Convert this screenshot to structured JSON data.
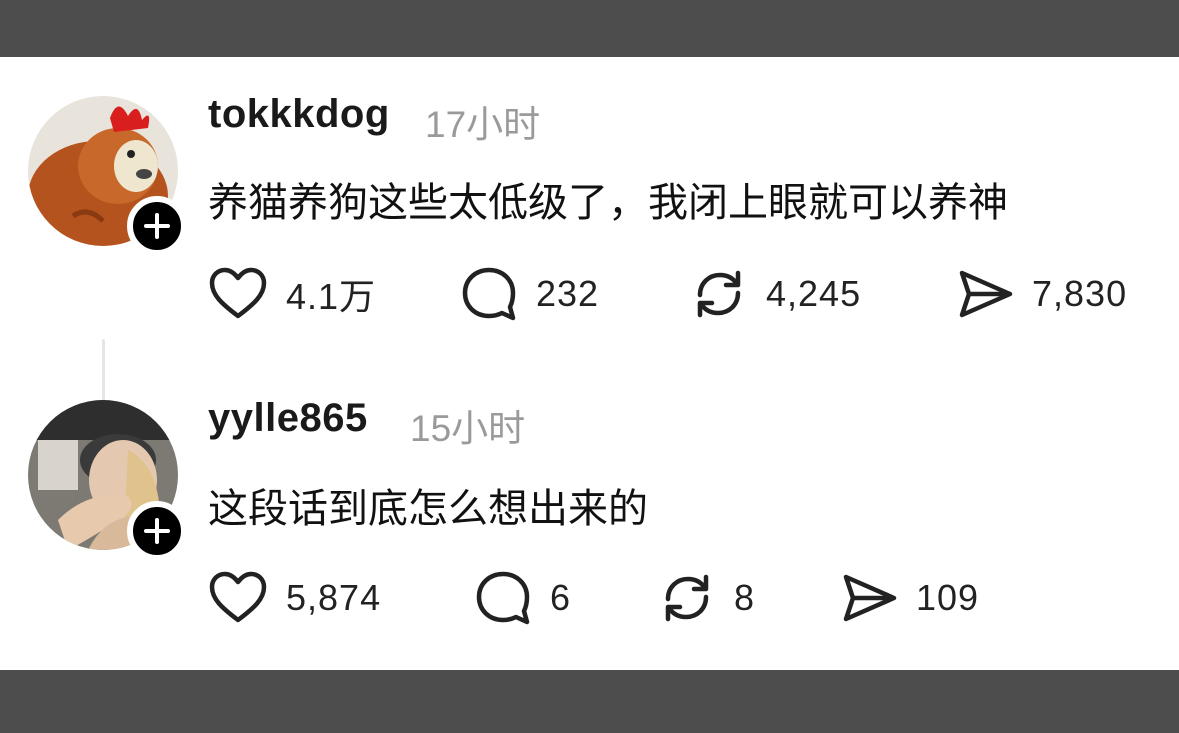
{
  "posts": [
    {
      "username": "tokkkdog",
      "time": "17小时",
      "text": "养猫养狗这些太低级了，我闭上眼就可以养神",
      "avatar_icon": "rooster-cartoon-avatar",
      "actions": {
        "likes": "4.1万",
        "comments": "232",
        "reposts": "4,245",
        "shares": "7,830"
      }
    },
    {
      "username": "yylle865",
      "time": "15小时",
      "text": "这段话到底怎么想出来的",
      "avatar_icon": "person-photo-avatar",
      "actions": {
        "likes": "5,874",
        "comments": "6",
        "reposts": "8",
        "shares": "109"
      }
    }
  ],
  "icons": {
    "like": "heart-icon",
    "comment": "comment-bubble-icon",
    "repost": "repost-icon",
    "share": "send-icon",
    "follow": "plus-icon"
  },
  "colors": {
    "frame": "#4d4d4d",
    "card": "#ffffff",
    "username": "#1a1a1a",
    "time": "#9a9a9a"
  }
}
